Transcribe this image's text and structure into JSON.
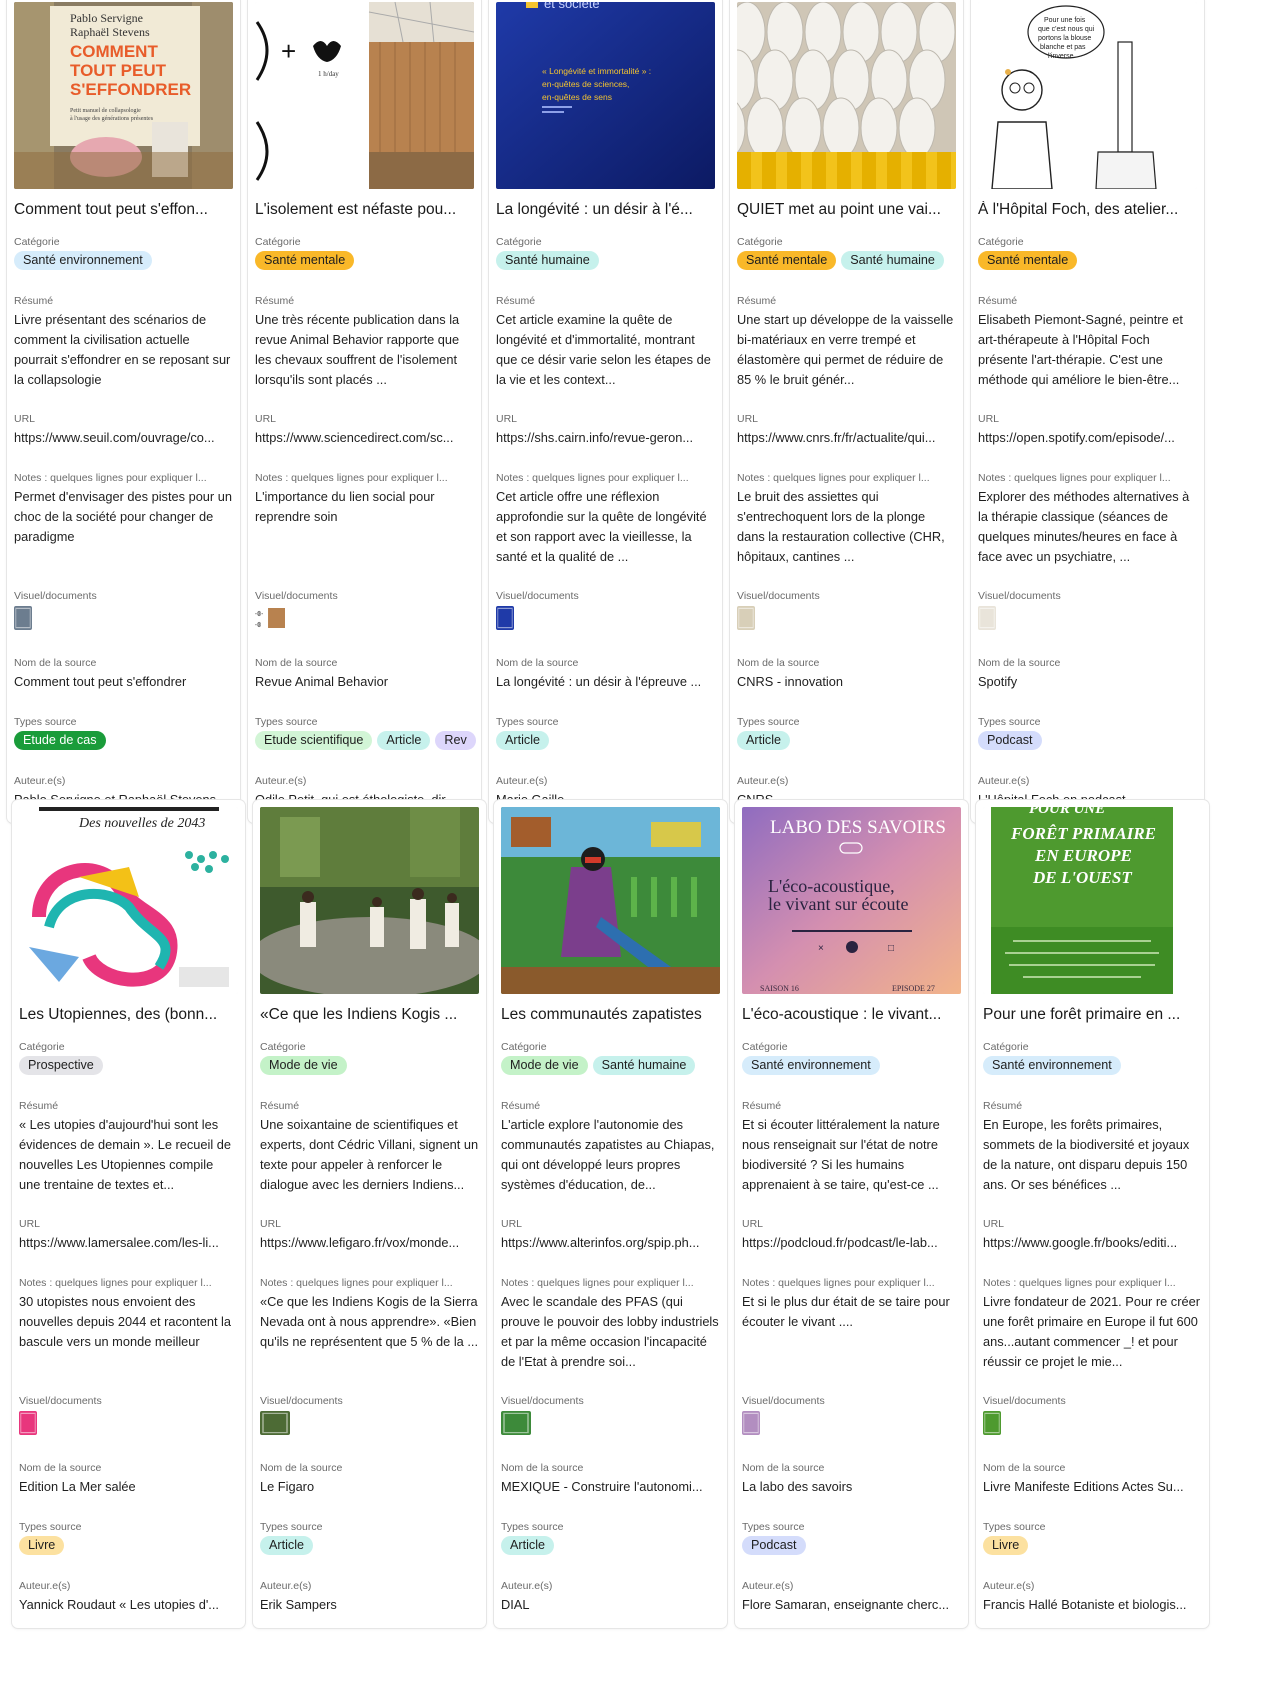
{
  "labels": {
    "categorie": "Catégorie",
    "resume": "Résumé",
    "url": "URL",
    "notes": "Notes : quelques lignes pour expliquer l...",
    "visuel": "Visuel/documents",
    "nom_source": "Nom de la source",
    "types_source": "Types source",
    "auteurs": "Auteur.e(s)"
  },
  "tag_colors": {
    "Santé environnement": "#d6ecfb",
    "Santé mentale": "#f9b829",
    "Santé humaine": "#c6f1ec",
    "Prospective": "#e4e4e8",
    "Mode de vie": "#c4f2c8",
    "Etude de cas": "#1a9c3a",
    "Etude scientifique": "#d2f5d6",
    "Article": "#c6f1ec",
    "Rev": "#ddd6fb",
    "Podcast": "#d4dcfb",
    "Livre": "#fce1a0"
  },
  "cards": [
    {
      "title": "Comment tout peut s'effon...",
      "cover": {
        "lines": [
          "Pablo Servigne",
          "Raphaël Stevens",
          "COMMENT",
          "TOUT PEUT",
          "S'EFFONDRER",
          "Petit manuel de collapsologie",
          "à l'usage des générations présentes"
        ]
      },
      "categories": [
        "Santé environnement"
      ],
      "resume": "Livre présentant des scénarios de comment la civilisation actuelle pourrait s'effondrer en se reposant sur la collapsologie",
      "url": "https://www.seuil.com/ouvrage/co...",
      "notes": "Permet d'envisager des pistes pour un choc de la société pour changer de paradigme",
      "source_name": "Comment tout peut s'effondrer",
      "source_types": [
        "Etude de cas"
      ],
      "authors": "Pablo Servigne et Raphaël Stevens"
    },
    {
      "title": "L'isolement est néfaste pou...",
      "cover": {
        "lines": [
          "1 h/day"
        ]
      },
      "categories": [
        "Santé mentale"
      ],
      "resume": "Une très récente publication dans la revue Animal Behavior rapporte que les chevaux souffrent de l'isolement lorsqu'ils sont placés ...",
      "url": "https://www.sciencedirect.com/sc...",
      "notes": "L'importance du lien social pour reprendre soin",
      "source_name": "Revue Animal Behavior",
      "source_types": [
        "Etude scientifique",
        "Article",
        "Rev"
      ],
      "authors": "Odile Petit, qui est éthologiste, dir..."
    },
    {
      "title": "La longévité : un désir à l'é...",
      "cover": {
        "lines": [
          "et société",
          "« Longévité et immortalité » :",
          "en-quêtes de sciences,",
          "en-quêtes de sens"
        ]
      },
      "categories": [
        "Santé humaine"
      ],
      "resume": "Cet article examine la quête de longévité et d'immortalité, montrant que ce désir varie selon les étapes de la vie et les context...",
      "url": "https://shs.cairn.info/revue-geron...",
      "notes": "Cet article offre une réflexion approfondie sur la quête de longévité et son rapport avec la vieillesse, la santé et la qualité de ...",
      "source_name": "La longévité : un désir à l'épreuve ...",
      "source_types": [
        "Article"
      ],
      "authors": "Marie Gaille"
    },
    {
      "title": "QUIET met au point une vai...",
      "cover": {
        "lines": []
      },
      "categories": [
        "Santé mentale",
        "Santé humaine"
      ],
      "resume": "Une start up développe de la vaisselle bi-matériaux en verre trempé et élastomère qui permet de réduire de 85 % le bruit génér...",
      "url": "https://www.cnrs.fr/fr/actualite/qui...",
      "notes": "Le bruit des assiettes qui s'entrechoquent lors de la plonge dans la restauration collective (CHR, hôpitaux, cantines ...",
      "source_name": "CNRS - innovation",
      "source_types": [
        "Article"
      ],
      "authors": "CNRS"
    },
    {
      "title": "À l'Hôpital Foch, des atelier...",
      "cover": {
        "lines": [
          "Pour une fois",
          "que c'est nous qui",
          "portons la blouse",
          "blanche et pas",
          "l'inverse"
        ]
      },
      "categories": [
        "Santé mentale"
      ],
      "resume": "Elisabeth Piemont-Sagné, peintre et art-thérapeute à l'Hôpital Foch présente l'art-thérapie. C'est une méthode qui améliore le bien-être...",
      "url": "https://open.spotify.com/episode/...",
      "notes": "Explorer des méthodes alternatives à la thérapie classique (séances de quelques minutes/heures en face à face avec un psychiatre, ...",
      "source_name": "Spotify",
      "source_types": [
        "Podcast"
      ],
      "authors": "L'Hôpital Foch en podcast"
    },
    {
      "title": "Les Utopiennes, des (bonn...",
      "cover": {
        "lines": [
          "Des nouvelles de 2043"
        ]
      },
      "categories": [
        "Prospective"
      ],
      "resume": "« Les utopies d'aujourd'hui sont les évidences de demain ». Le recueil de nouvelles Les Utopiennes compile une trentaine de textes et...",
      "url": "https://www.lamersalee.com/les-li...",
      "notes": " 30 utopistes nous envoient des nouvelles depuis 2044 et racontent la bascule vers un monde meilleur",
      "source_name": "Edition La Mer salée",
      "source_types": [
        "Livre"
      ],
      "authors": "Yannick Roudaut « Les utopies d'..."
    },
    {
      "title": "«Ce que les Indiens Kogis ...",
      "cover": {
        "lines": []
      },
      "categories": [
        "Mode de vie"
      ],
      "resume": " Une soixantaine de scientifiques et experts, dont Cédric Villani, signent un texte pour appeler à renforcer le dialogue avec les derniers Indiens...",
      "url": "https://www.lefigaro.fr/vox/monde...",
      "notes": "«Ce que les Indiens Kogis de la Sierra Nevada ont à nous apprendre». «Bien qu'ils ne représentent que 5 % de la ...",
      "source_name": "Le Figaro",
      "source_types": [
        "Article"
      ],
      "authors": "Erik Sampers"
    },
    {
      "title": "Les communautés zapatistes",
      "cover": {
        "lines": []
      },
      "categories": [
        "Mode de vie",
        "Santé humaine"
      ],
      "resume": "L'article explore l'autonomie des communautés zapatistes au Chiapas, qui ont développé leurs propres systèmes d'éducation, de...",
      "url": "https://www.alterinfos.org/spip.ph...",
      "notes": "Avec le scandale des PFAS (qui prouve le pouvoir des lobby industriels et par la même occasion l'incapacité de l'Etat à prendre soi...",
      "source_name": "MEXIQUE - Construire l'autonomi...",
      "source_types": [
        "Article"
      ],
      "authors": "DIAL"
    },
    {
      "title": "L'éco-acoustique : le vivant...",
      "cover": {
        "lines": [
          "LABO DES SAVOIRS",
          "L'éco-acoustique,",
          "le vivant sur écoute",
          "SAISON 16",
          "EPISODE 27"
        ]
      },
      "categories": [
        "Santé environnement"
      ],
      "resume": "Et si écouter littéralement la nature nous renseignait sur l'état de notre biodiversité ? Si les humains apprenaient à se taire, qu'est-ce ...",
      "url": "https://podcloud.fr/podcast/le-lab...",
      "notes": "Et si le plus dur était de se taire pour écouter le vivant ....",
      "source_name": "La labo des savoirs",
      "source_types": [
        "Podcast"
      ],
      "authors": "Flore Samaran, enseignante cherc..."
    },
    {
      "title": "Pour une forêt primaire en ...",
      "cover": {
        "lines": [
          "POUR UNE",
          "FORÊT PRIMAIRE",
          "EN EUROPE",
          "DE L'OUEST"
        ]
      },
      "categories": [
        "Santé environnement"
      ],
      "resume": "En Europe, les forêts primaires, sommets de la biodiversité et joyaux de la nature, ont disparu depuis 150 ans. Or ses bénéfices ...",
      "url": "https://www.google.fr/books/editi...",
      "notes": "Livre fondateur de 2021. Pour re créer une forêt primaire en Europe il fut 600 ans...autant commencer _! et pour réussir ce projet le mie...",
      "source_name": "Livre Manifeste Editions Actes Su...",
      "source_types": [
        "Livre"
      ],
      "authors": "Francis Hallé Botaniste et biologis..."
    }
  ]
}
